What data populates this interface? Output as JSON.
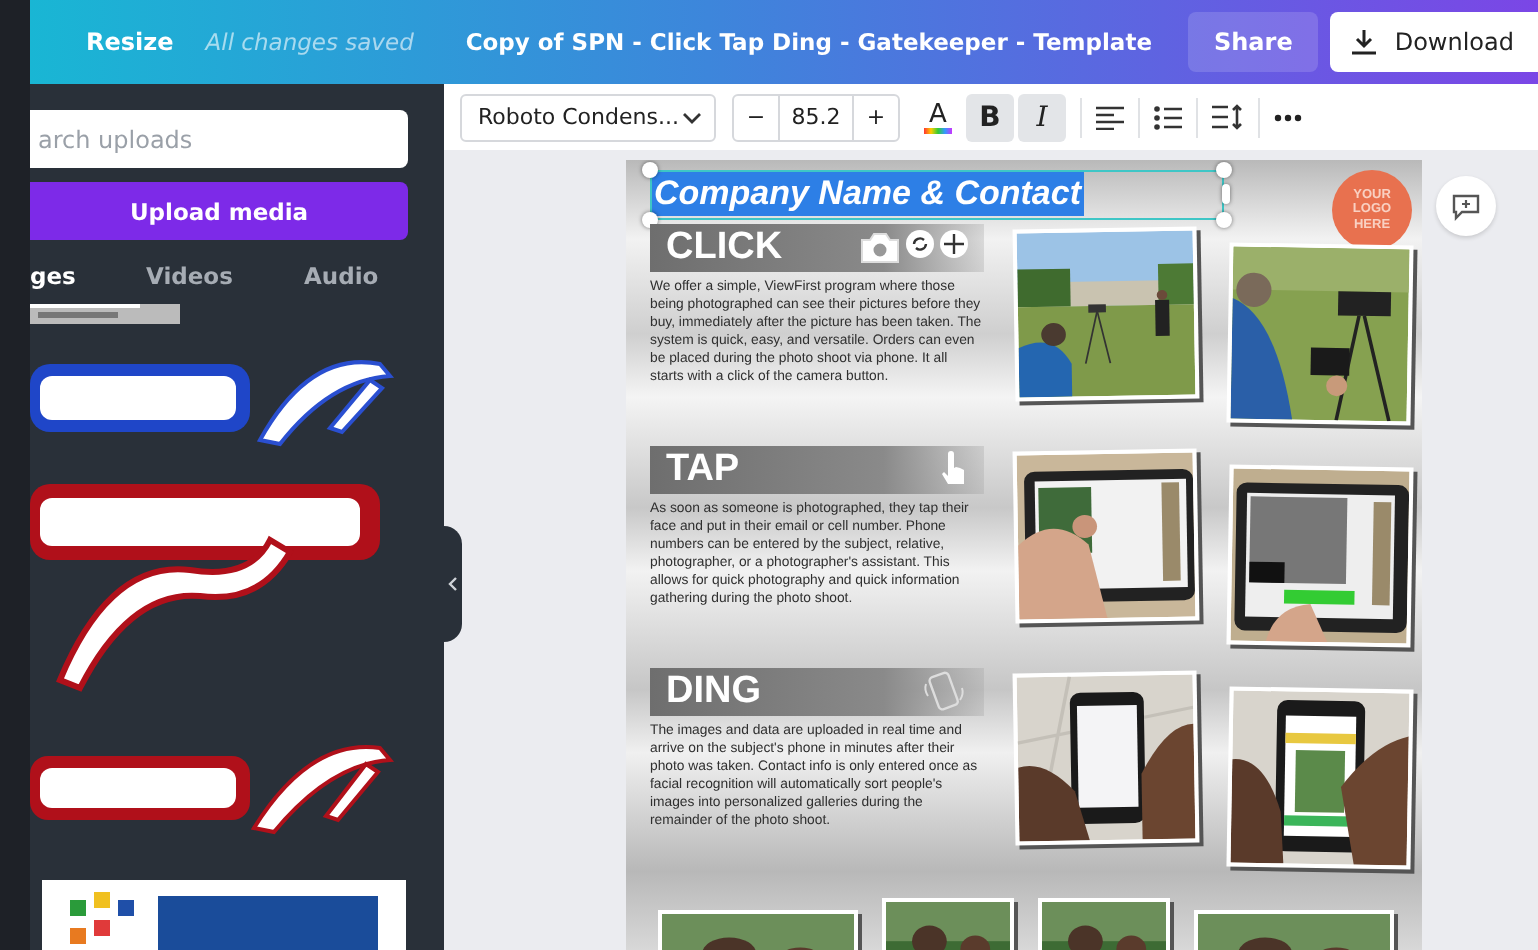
{
  "topbar": {
    "resize": "Resize",
    "save_status": "All changes saved",
    "title": "Copy of SPN - Click Tap Ding - Gatekeeper - Template",
    "share": "Share",
    "download": "Download"
  },
  "sidebar": {
    "search": {
      "placeholder": "arch uploads"
    },
    "upload_button": "Upload media",
    "tabs": [
      {
        "label": "ges",
        "selected": true
      },
      {
        "label": "Videos",
        "selected": false
      },
      {
        "label": "Audio",
        "selected": false
      }
    ],
    "items": [
      {
        "kind": "strip"
      },
      {
        "kind": "blue-logo"
      },
      {
        "kind": "red-logo-large"
      },
      {
        "kind": "red-logo"
      },
      {
        "kind": "white-logo"
      }
    ]
  },
  "toolbar": {
    "font": "Roboto Condens...",
    "font_size": "85.2",
    "minus": "−",
    "plus": "+",
    "text_color": "A",
    "bold": {
      "label": "B",
      "on": true
    },
    "italic": {
      "label": "I",
      "on": true
    }
  },
  "page": {
    "title": "Company Name & Contact",
    "title_selected": true,
    "logo": "YOUR LOGO HERE",
    "sections": [
      {
        "kind": "camera",
        "heading": "CLICK",
        "body": "We offer a simple, ViewFirst program where those being photographed can see their pictures before they buy, immediately after the picture has been taken. The system is quick, easy, and versatile. Orders can even be placed during the photo shoot via phone. It all starts with a click of the camera button."
      },
      {
        "kind": "hand",
        "heading": "TAP",
        "body": "As soon as someone is photographed, they tap their face and put in their email or cell number. Phone numbers can be entered by the subject, relative, photographer, or a photographer's assistant. This allows for quick photography and quick information gathering during the photo shoot."
      },
      {
        "kind": "phone",
        "heading": "DING",
        "body": "The images and data are uploaded in real time and arrive on the subject's phone in minutes after their photo was taken. Contact info is only entered once as facial recognition will automatically sort people's images into personalized galleries during the remainder of the photo shoot."
      }
    ]
  }
}
